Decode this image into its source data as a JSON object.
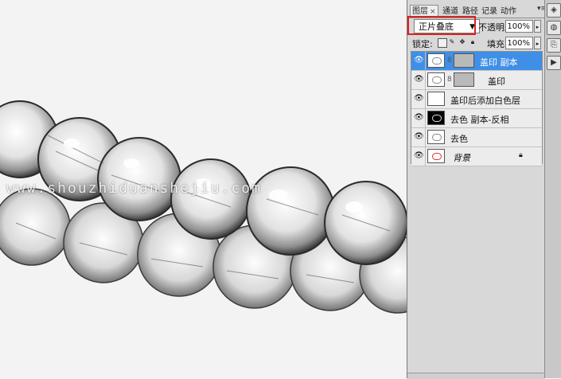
{
  "canvas": {
    "watermark": "www.shouzhiduanshejiu.com"
  },
  "layers_panel": {
    "tabs": [
      {
        "label": "图层",
        "active": true,
        "closable": true
      },
      {
        "label": "通道"
      },
      {
        "label": "路径"
      },
      {
        "label": "记录"
      },
      {
        "label": "动作"
      }
    ],
    "blend_mode": "正片叠底",
    "opacity_label": "不透明度:",
    "opacity_value": "100%",
    "lock_label": "锁定:",
    "fill_label": "填充:",
    "fill_value": "100%",
    "layers": [
      {
        "name": "盖印 副本",
        "selected": true,
        "has_mask": true
      },
      {
        "name": "盖印",
        "selected": false,
        "has_mask": true
      },
      {
        "name": "盖印后添加白色层",
        "selected": false,
        "has_mask": false
      },
      {
        "name": "去色 副本-反相",
        "selected": false,
        "has_mask": false,
        "thumb": "black"
      },
      {
        "name": "去色",
        "selected": false,
        "has_mask": false
      },
      {
        "name": "背景",
        "selected": false,
        "has_mask": false,
        "italic": true,
        "locked": true
      }
    ]
  },
  "highlight_color": "#dd2222",
  "selection_color": "#3f8fe6"
}
